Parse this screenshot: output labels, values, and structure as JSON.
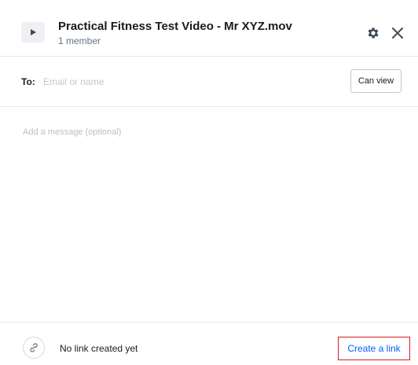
{
  "header": {
    "file_title": "Practical Fitness Test Video - Mr XYZ.mov",
    "member_count": "1 member"
  },
  "icons": {
    "file": "play-icon",
    "settings": "gear-icon",
    "close": "close-icon",
    "link": "link-icon"
  },
  "to_row": {
    "label": "To:",
    "placeholder": "Email or name",
    "permission": "Can view"
  },
  "message": {
    "placeholder": "Add a message (optional)"
  },
  "footer": {
    "link_status": "No link created yet",
    "create_link_label": "Create a link"
  },
  "colors": {
    "accent_blue": "#0061fe",
    "highlight_red": "#e0171f",
    "text_dark": "#1e1919",
    "text_muted": "#637282"
  }
}
